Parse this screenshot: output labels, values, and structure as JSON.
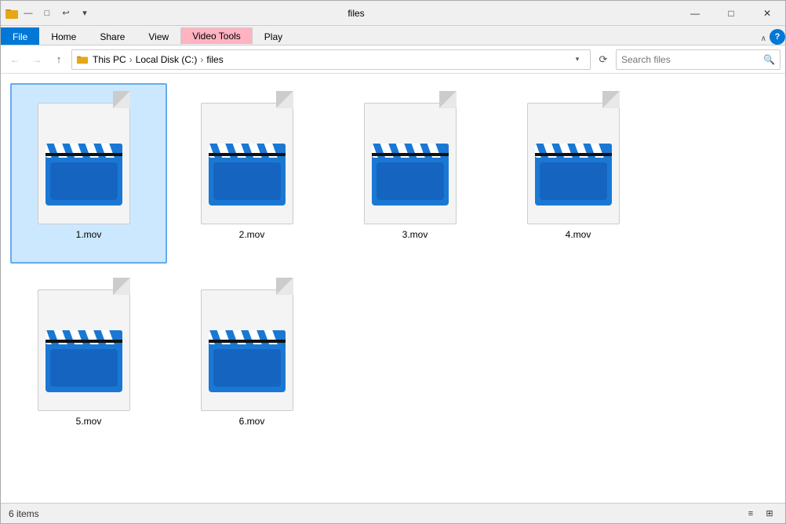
{
  "titlebar": {
    "title": "files",
    "minimize_label": "—",
    "maximize_label": "□",
    "close_label": "✕"
  },
  "ribbon": {
    "tabs": [
      {
        "id": "file",
        "label": "File",
        "active": true,
        "style": "file"
      },
      {
        "id": "home",
        "label": "Home",
        "style": "normal"
      },
      {
        "id": "share",
        "label": "Share",
        "style": "normal"
      },
      {
        "id": "view",
        "label": "View",
        "style": "normal"
      },
      {
        "id": "videotools",
        "label": "Video Tools",
        "style": "video"
      },
      {
        "id": "play",
        "label": "Play",
        "style": "normal"
      }
    ],
    "chevron": "∨",
    "help": "?"
  },
  "address": {
    "back_label": "←",
    "forward_label": "→",
    "up_label": "↑",
    "breadcrumbs": [
      "This PC",
      "Local Disk (C:)",
      "files"
    ],
    "refresh_label": "⟳",
    "search_placeholder": "Search files"
  },
  "files": [
    {
      "name": "1.mov",
      "selected": true
    },
    {
      "name": "2.mov",
      "selected": false
    },
    {
      "name": "3.mov",
      "selected": false
    },
    {
      "name": "4.mov",
      "selected": false
    },
    {
      "name": "5.mov",
      "selected": false
    },
    {
      "name": "6.mov",
      "selected": false
    }
  ],
  "statusbar": {
    "items_label": "6 items"
  },
  "colors": {
    "blue_dark": "#0078d7",
    "blue_clapper": "#1a78d4",
    "clapper_stripe": "#1565c0"
  }
}
